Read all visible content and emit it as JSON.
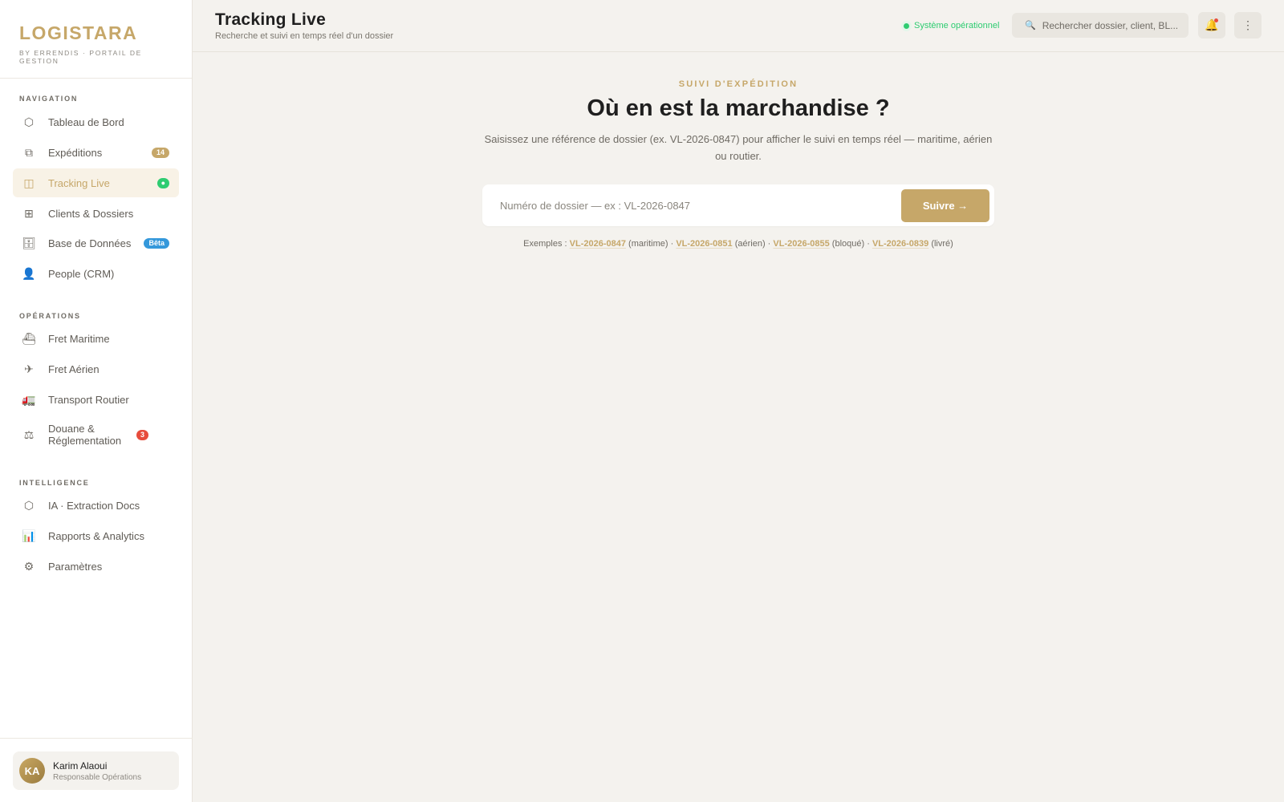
{
  "brand": {
    "name": "LOGISTARA",
    "subtitle": "BY ERRENDIS · PORTAIL DE GESTION"
  },
  "sidebar": {
    "sections": [
      {
        "title": "NAVIGATION",
        "items": [
          {
            "label": "Tableau de Bord",
            "icon": "hexagon-icon"
          },
          {
            "label": "Expéditions",
            "icon": "layers-icon",
            "badge": "14"
          },
          {
            "label": "Tracking Live",
            "icon": "map-icon",
            "badge": "●",
            "active": true
          },
          {
            "label": "Clients & Dossiers",
            "icon": "grid-icon"
          },
          {
            "label": "Base de Données",
            "icon": "database-icon",
            "badge": "Bêta"
          },
          {
            "label": "People (CRM)",
            "icon": "user-icon"
          }
        ]
      },
      {
        "title": "OPÉRATIONS",
        "items": [
          {
            "label": "Fret Maritime",
            "icon": "ship-icon"
          },
          {
            "label": "Fret Aérien",
            "icon": "plane-icon"
          },
          {
            "label": "Transport Routier",
            "icon": "truck-icon"
          },
          {
            "label": "Douane & Réglementation",
            "icon": "scale-icon",
            "badge": "3"
          }
        ]
      },
      {
        "title": "INTELLIGENCE",
        "items": [
          {
            "label": "IA · Extraction Docs",
            "icon": "hexagon-icon"
          },
          {
            "label": "Rapports & Analytics",
            "icon": "bar-chart-icon"
          },
          {
            "label": "Paramètres",
            "icon": "gear-icon"
          }
        ]
      }
    ]
  },
  "user": {
    "initials": "KA",
    "name": "Karim Alaoui",
    "role": "Responsable Opérations"
  },
  "header": {
    "title": "Tracking Live",
    "subtitle": "Recherche et suivi en temps réel d'un dossier",
    "status": "Système opérationnel",
    "search_placeholder": "Rechercher dossier, client, BL..."
  },
  "main": {
    "eyebrow": "SUIVI D'EXPÉDITION",
    "title": "Où en est la marchandise ?",
    "description": "Saisissez une référence de dossier (ex. VL-2026-0847) pour afficher le suivi en temps réel — maritime, aérien ou routier.",
    "input_placeholder": "Numéro de dossier — ex : VL-2026-0847",
    "button_label": "Suivre →",
    "examples_label": "Exemples :",
    "examples": [
      {
        "ref": "VL-2026-0847",
        "type": "(maritime)"
      },
      {
        "ref": "VL-2026-0851",
        "type": "(aérien)"
      },
      {
        "ref": "VL-2026-0855",
        "type": "(bloqué)"
      },
      {
        "ref": "VL-2026-0839",
        "type": "(livré)"
      }
    ]
  },
  "colors": {
    "accent": "#c6a769",
    "success": "#2ecc71",
    "danger": "#e74c3c",
    "info": "#3498db"
  }
}
